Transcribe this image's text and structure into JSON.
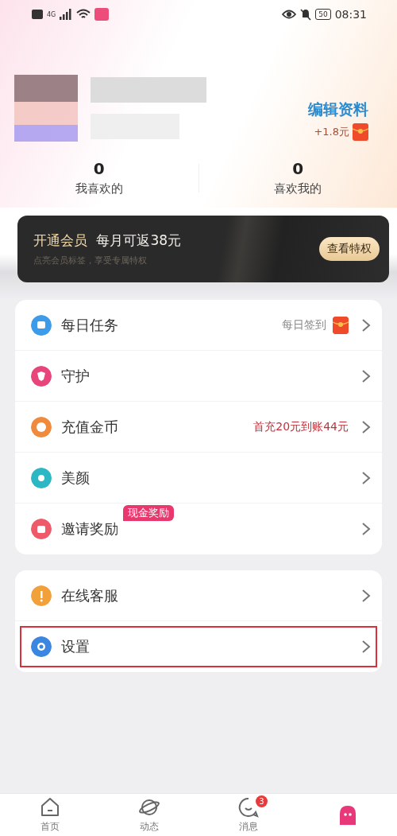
{
  "status_bar": {
    "time": "08:31",
    "battery": "50",
    "network": "4G"
  },
  "profile": {
    "edit_link": "编辑资料",
    "reward": "+1.8元"
  },
  "stats": [
    {
      "value": "0",
      "label": "我喜欢的"
    },
    {
      "value": "0",
      "label": "喜欢我的"
    }
  ],
  "vip_banner": {
    "title": "开通会员",
    "offer": "每月可返38元",
    "subtitle": "点亮会员标签，享受专属特权",
    "button": "查看特权"
  },
  "menu_groups": [
    {
      "items": [
        {
          "kind": "calendar",
          "label": "每日任务",
          "note": "每日签到",
          "promo": false,
          "red_packet": true,
          "highlighted": false,
          "color": "#3d9be9"
        },
        {
          "kind": "shield",
          "label": "守护",
          "highlighted": false,
          "color": "#e8457a"
        },
        {
          "kind": "coin",
          "label": "充值金币",
          "note": "首充20元到账44元",
          "promo": true,
          "highlighted": false,
          "color": "#f08a3c"
        },
        {
          "kind": "beauty",
          "label": "美颜",
          "highlighted": false,
          "color": "#2bb7c4"
        },
        {
          "kind": "gift",
          "label": "邀请奖励",
          "badge": "现金奖励",
          "highlighted": false,
          "color": "#ef5a6a"
        }
      ]
    },
    {
      "items": [
        {
          "kind": "service",
          "label": "在线客服",
          "highlighted": false,
          "color": "#f2a03a"
        },
        {
          "kind": "settings",
          "label": "设置",
          "highlighted": true,
          "color": "#3a86e0"
        }
      ]
    }
  ],
  "tab_bar": [
    {
      "kind": "home",
      "label": "首页",
      "selected": false
    },
    {
      "kind": "planet",
      "label": "动态",
      "selected": false
    },
    {
      "kind": "chat",
      "label": "消息",
      "badge": "3",
      "selected": false
    },
    {
      "kind": "mascot",
      "selected": true
    }
  ]
}
